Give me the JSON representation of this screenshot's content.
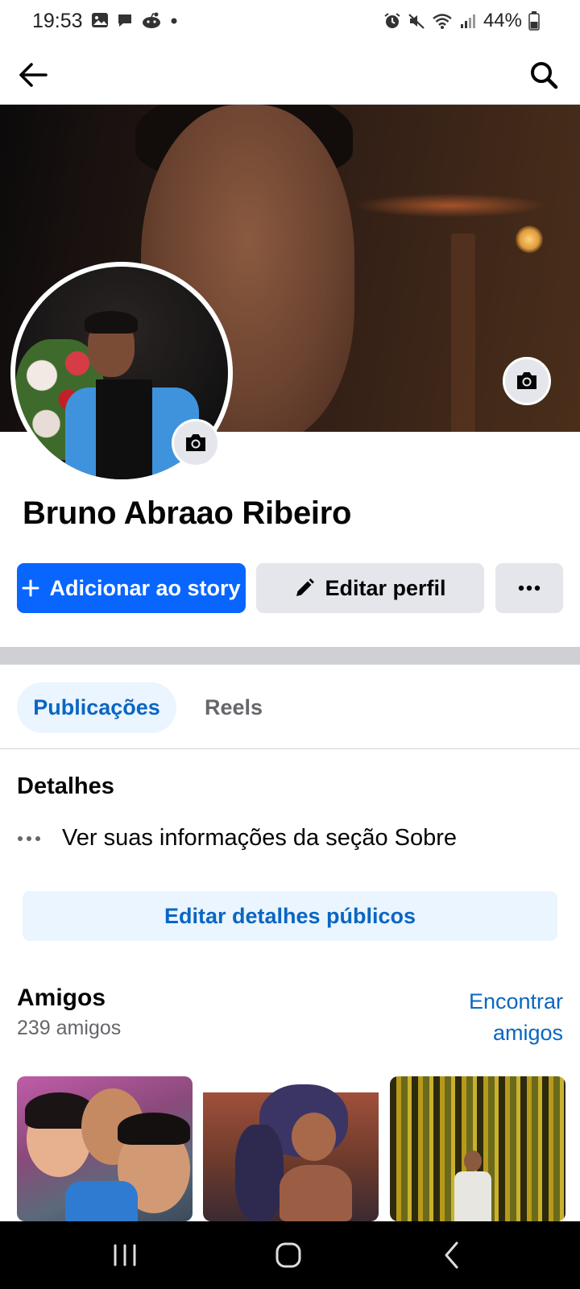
{
  "status_bar": {
    "time": "19:53",
    "left_icons": [
      "image-icon",
      "chat-bubble-icon",
      "reddit-icon",
      "dot-icon"
    ],
    "right_icons": [
      "alarm-icon",
      "mute-icon",
      "wifi-icon",
      "signal-icon"
    ],
    "battery_percent": "44%"
  },
  "app_bar": {
    "back_icon": "arrow-left-icon",
    "search_icon": "search-icon"
  },
  "profile": {
    "name": "Bruno Abraao Ribeiro"
  },
  "actions": {
    "add_story": "Adicionar ao story",
    "edit_profile": "Editar perfil",
    "more_icon": "ellipsis-icon"
  },
  "tabs": [
    {
      "label": "Publicações",
      "selected": true
    },
    {
      "label": "Reels",
      "selected": false
    }
  ],
  "details": {
    "heading": "Detalhes",
    "about_row": "Ver suas informações da seção Sobre",
    "edit_button": "Editar detalhes públicos"
  },
  "friends": {
    "heading": "Amigos",
    "count": "239 amigos",
    "find_link": "Encontrar amigos"
  },
  "colors": {
    "primary_blue": "#0866ff",
    "link_blue": "#0a66c2",
    "secondary_button": "#e4e6eb",
    "selected_tab_bg": "#ebf5ff",
    "separator": "#ced0d4",
    "muted_text": "#65676b"
  }
}
